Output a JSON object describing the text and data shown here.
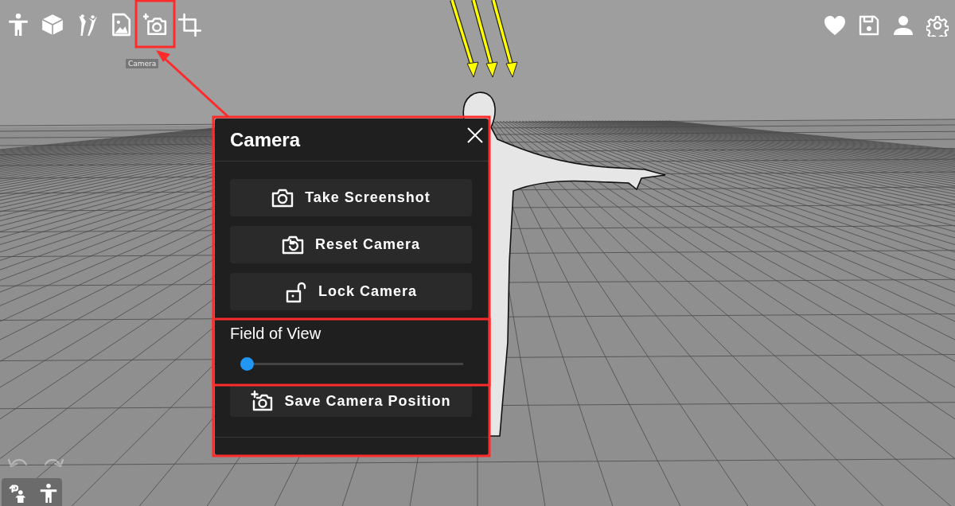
{
  "toolbar_left": [
    {
      "kind": "figure"
    },
    {
      "kind": "cube"
    },
    {
      "kind": "dancers"
    },
    {
      "kind": "image"
    },
    {
      "kind": "camera"
    },
    {
      "kind": "crop"
    }
  ],
  "tooltip": {
    "text": "Camera"
  },
  "toolbar_right": [
    {
      "kind": "heart"
    },
    {
      "kind": "save"
    },
    {
      "kind": "user"
    },
    {
      "kind": "settings"
    }
  ],
  "camera_panel": {
    "title": "Camera",
    "buttons": [
      {
        "kind": "screenshot",
        "label": "Take Screenshot"
      },
      {
        "kind": "reset",
        "label": "Reset Camera"
      },
      {
        "kind": "lock",
        "label": "Lock Camera"
      }
    ],
    "field_of_view": {
      "label": "Field of View",
      "level": 0
    },
    "save_button": {
      "kind": "save-position",
      "label": "Save Camera Position"
    }
  },
  "history": {
    "undo_disabled": true,
    "redo_disabled": true
  },
  "bottom_tools": [
    {
      "kind": "pose-reset"
    },
    {
      "kind": "figure"
    }
  ]
}
